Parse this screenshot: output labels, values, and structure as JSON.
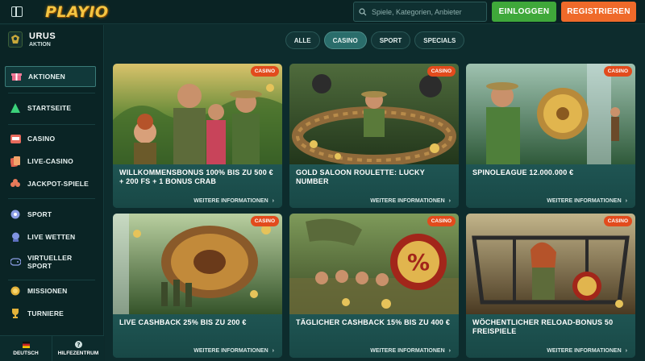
{
  "header": {
    "logo_text": "PLAYIO",
    "search_placeholder": "Spiele, Kategorien, Anbieter",
    "login_label": "EINLOGGEN",
    "register_label": "REGISTRIEREN"
  },
  "user": {
    "name": "URUS",
    "subtitle": "AKTION"
  },
  "sidebar": {
    "items": [
      {
        "label": "AKTIONEN",
        "icon": "gift-icon"
      },
      {
        "label": "STARTSEITE",
        "icon": "home-icon"
      },
      {
        "label": "CASINO",
        "icon": "slot-machine-icon"
      },
      {
        "label": "LIVE-CASINO",
        "icon": "cards-icon"
      },
      {
        "label": "JACKPOT-SPIELE",
        "icon": "clover-icon"
      },
      {
        "label": "SPORT",
        "icon": "ball-icon"
      },
      {
        "label": "LIVE WETTEN",
        "icon": "live-icon"
      },
      {
        "label": "VIRTUELLER SPORT",
        "icon": "gamepad-icon"
      },
      {
        "label": "MISSIONEN",
        "icon": "medal-icon"
      },
      {
        "label": "TURNIERE",
        "icon": "trophy-icon"
      }
    ],
    "footer": {
      "language": "DEUTSCH",
      "help": "HILFEZENTRUM"
    }
  },
  "filters": [
    "ALLE",
    "CASINO",
    "SPORT",
    "SPECIALS"
  ],
  "active_filter": "CASINO",
  "cards": [
    {
      "tag": "CASINO",
      "title": "WILLKOMMENSBONUS 100% BIS ZU 500 € + 200 FS + 1 BONUS CRAB",
      "more": "WEITERE INFORMATIONEN"
    },
    {
      "tag": "CASINO",
      "title": "GOLD SALOON ROULETTE: LUCKY NUMBER",
      "more": "WEITERE INFORMATIONEN"
    },
    {
      "tag": "CASINO",
      "title": "SPINOLEAGUE 12.000.000 €",
      "more": "WEITERE INFORMATIONEN"
    },
    {
      "tag": "CASINO",
      "title": "LIVE CASHBACK 25% BIS ZU 200 €",
      "more": "WEITERE INFORMATIONEN"
    },
    {
      "tag": "CASINO",
      "title": "TÄGLICHER CASHBACK 15% BIS ZU 400 €",
      "more": "WEITERE INFORMATIONEN"
    },
    {
      "tag": "CASINO",
      "title": "WÖCHENTLICHER RELOAD-BONUS 50 FREISPIELE",
      "more": "WEITERE INFORMATIONEN"
    }
  ],
  "colors": {
    "accent": "#2a6d6b",
    "login": "#3fa83a",
    "register": "#ef6a2a",
    "tag": "#e24b1d"
  }
}
